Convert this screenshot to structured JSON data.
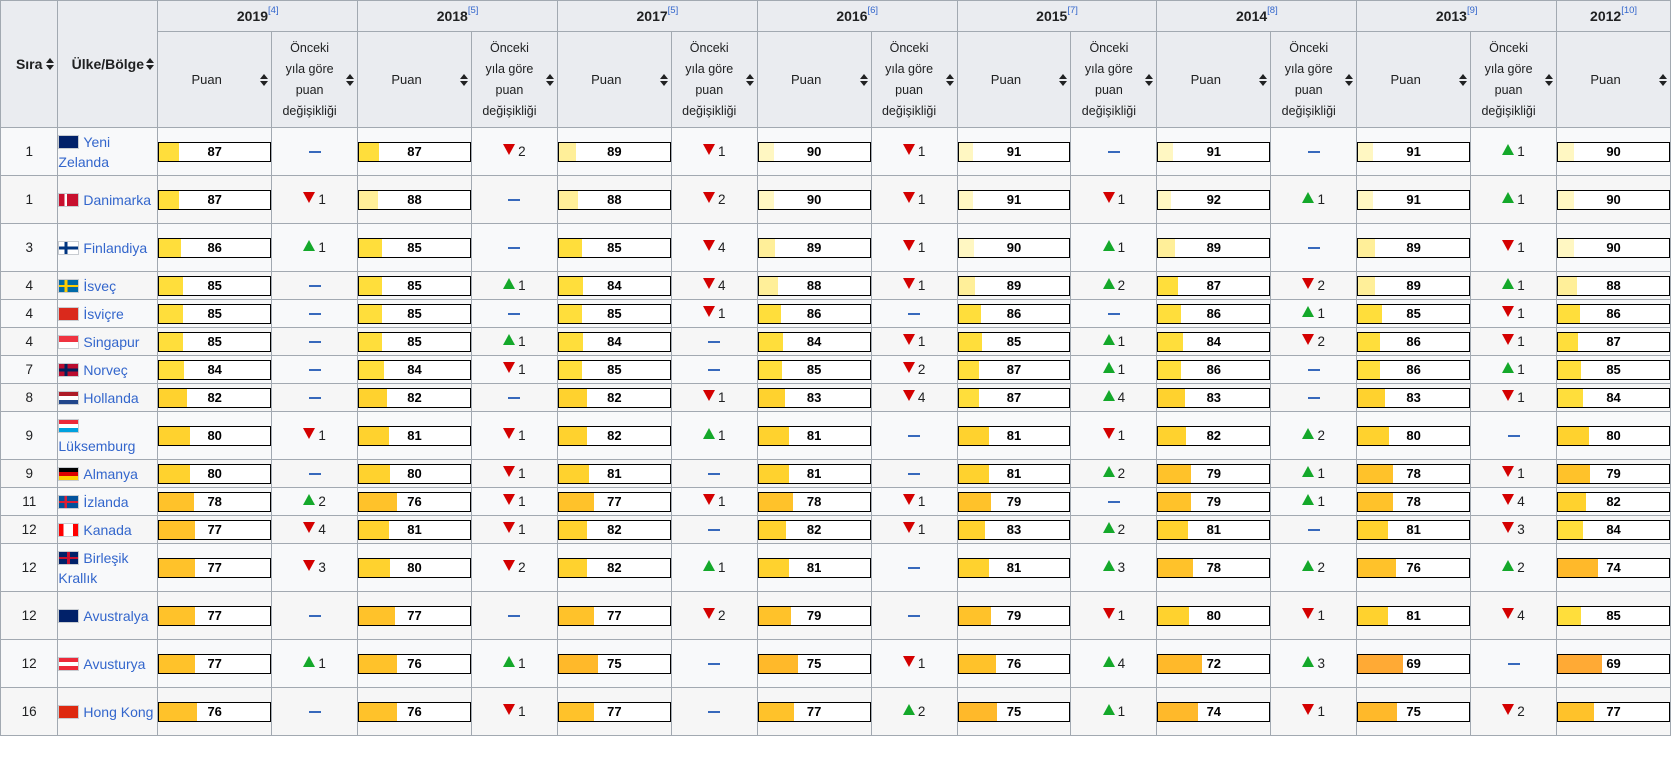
{
  "headers": {
    "rank": "Sıra",
    "country": "Ülke/Bölge",
    "score": "Puan",
    "change_lines": [
      "Önceki",
      "yıla göre",
      "puan",
      "değişikliği"
    ],
    "years": [
      {
        "year": "2019",
        "ref": "[4]"
      },
      {
        "year": "2018",
        "ref": "[5]"
      },
      {
        "year": "2017",
        "ref": "[5]"
      },
      {
        "year": "2016",
        "ref": "[6]"
      },
      {
        "year": "2015",
        "ref": "[7]"
      },
      {
        "year": "2014",
        "ref": "[8]"
      },
      {
        "year": "2013",
        "ref": "[9]"
      },
      {
        "year": "2012",
        "ref": "[10]"
      }
    ]
  },
  "flags": {
    "nz": {
      "icon": "new-zealand-flag-icon",
      "colors": [
        "#012169",
        "#c8102e"
      ]
    },
    "dk": {
      "icon": "denmark-flag-icon",
      "colors": [
        "#c8102e",
        "#ffffff"
      ]
    },
    "fi": {
      "icon": "finland-flag-icon",
      "colors": [
        "#ffffff",
        "#003580"
      ]
    },
    "se": {
      "icon": "sweden-flag-icon",
      "colors": [
        "#006aa7",
        "#fecc00"
      ]
    },
    "ch": {
      "icon": "switzerland-flag-icon",
      "colors": [
        "#da291c",
        "#ffffff"
      ]
    },
    "sg": {
      "icon": "singapore-flag-icon",
      "colors": [
        "#ef3340",
        "#ffffff"
      ]
    },
    "no": {
      "icon": "norway-flag-icon",
      "colors": [
        "#ba0c2f",
        "#ffffff",
        "#00205b"
      ]
    },
    "nl": {
      "icon": "netherlands-flag-icon",
      "colors": [
        "#ae1c28",
        "#ffffff",
        "#21468b"
      ]
    },
    "lu": {
      "icon": "luxembourg-flag-icon",
      "colors": [
        "#ed2939",
        "#ffffff",
        "#00a1de"
      ]
    },
    "de": {
      "icon": "germany-flag-icon",
      "colors": [
        "#000000",
        "#dd0000",
        "#ffce00"
      ]
    },
    "is": {
      "icon": "iceland-flag-icon",
      "colors": [
        "#02529c",
        "#ffffff",
        "#dc1e35"
      ]
    },
    "ca": {
      "icon": "canada-flag-icon",
      "colors": [
        "#ff0000",
        "#ffffff"
      ]
    },
    "gb": {
      "icon": "united-kingdom-flag-icon",
      "colors": [
        "#012169",
        "#ffffff",
        "#c8102e"
      ]
    },
    "au": {
      "icon": "australia-flag-icon",
      "colors": [
        "#012169",
        "#ffffff",
        "#e4002b"
      ]
    },
    "at": {
      "icon": "austria-flag-icon",
      "colors": [
        "#ed2939",
        "#ffffff"
      ]
    },
    "hk": {
      "icon": "hong-kong-flag-icon",
      "colors": [
        "#de2910",
        "#ffffff"
      ]
    }
  },
  "rows": [
    {
      "rank": "1",
      "country": [
        "Yeni",
        "Zelanda"
      ],
      "flag": "nz",
      "cells": [
        [
          "87",
          ""
        ],
        [
          "87",
          "d2"
        ],
        [
          "89",
          "d1"
        ],
        [
          "90",
          "d1"
        ],
        [
          "91",
          ""
        ],
        [
          "91",
          ""
        ],
        [
          "91",
          "u1"
        ],
        [
          "90"
        ]
      ]
    },
    {
      "rank": "1",
      "country": [
        "Danimarka"
      ],
      "flag": "dk",
      "cells": [
        [
          "87",
          "d1"
        ],
        [
          "88",
          ""
        ],
        [
          "88",
          "d2"
        ],
        [
          "90",
          "d1"
        ],
        [
          "91",
          "d1"
        ],
        [
          "92",
          "u1"
        ],
        [
          "91",
          "u1"
        ],
        [
          "90"
        ]
      ]
    },
    {
      "rank": "3",
      "country": [
        "Finlandiya"
      ],
      "flag": "fi",
      "cells": [
        [
          "86",
          "u1"
        ],
        [
          "85",
          ""
        ],
        [
          "85",
          "d4"
        ],
        [
          "89",
          "d1"
        ],
        [
          "90",
          "u1"
        ],
        [
          "89",
          ""
        ],
        [
          "89",
          "d1"
        ],
        [
          "90"
        ]
      ]
    },
    {
      "rank": "4",
      "country": [
        "İsveç"
      ],
      "flag": "se",
      "cells": [
        [
          "85",
          ""
        ],
        [
          "85",
          "u1"
        ],
        [
          "84",
          "d4"
        ],
        [
          "88",
          "d1"
        ],
        [
          "89",
          "u2"
        ],
        [
          "87",
          "d2"
        ],
        [
          "89",
          "u1"
        ],
        [
          "88"
        ]
      ]
    },
    {
      "rank": "4",
      "country": [
        "İsviçre"
      ],
      "flag": "ch",
      "cells": [
        [
          "85",
          ""
        ],
        [
          "85",
          ""
        ],
        [
          "85",
          "d1"
        ],
        [
          "86",
          ""
        ],
        [
          "86",
          ""
        ],
        [
          "86",
          "u1"
        ],
        [
          "85",
          "d1"
        ],
        [
          "86"
        ]
      ]
    },
    {
      "rank": "4",
      "country": [
        "Singapur"
      ],
      "flag": "sg",
      "cells": [
        [
          "85",
          ""
        ],
        [
          "85",
          "u1"
        ],
        [
          "84",
          ""
        ],
        [
          "84",
          "d1"
        ],
        [
          "85",
          "u1"
        ],
        [
          "84",
          "d2"
        ],
        [
          "86",
          "d1"
        ],
        [
          "87"
        ]
      ]
    },
    {
      "rank": "7",
      "country": [
        "Norveç"
      ],
      "flag": "no",
      "cells": [
        [
          "84",
          ""
        ],
        [
          "84",
          "d1"
        ],
        [
          "85",
          ""
        ],
        [
          "85",
          "d2"
        ],
        [
          "87",
          "u1"
        ],
        [
          "86",
          ""
        ],
        [
          "86",
          "u1"
        ],
        [
          "85"
        ]
      ]
    },
    {
      "rank": "8",
      "country": [
        "Hollanda"
      ],
      "flag": "nl",
      "cells": [
        [
          "82",
          ""
        ],
        [
          "82",
          ""
        ],
        [
          "82",
          "d1"
        ],
        [
          "83",
          "d4"
        ],
        [
          "87",
          "u4"
        ],
        [
          "83",
          ""
        ],
        [
          "83",
          "d1"
        ],
        [
          "84"
        ]
      ]
    },
    {
      "rank": "9",
      "country": [
        "Lüksemburg"
      ],
      "flag": "lu",
      "cells": [
        [
          "80",
          "d1"
        ],
        [
          "81",
          "d1"
        ],
        [
          "82",
          "u1"
        ],
        [
          "81",
          ""
        ],
        [
          "81",
          "d1"
        ],
        [
          "82",
          "u2"
        ],
        [
          "80",
          ""
        ],
        [
          "80"
        ]
      ]
    },
    {
      "rank": "9",
      "country": [
        "Almanya"
      ],
      "flag": "de",
      "cells": [
        [
          "80",
          ""
        ],
        [
          "80",
          "d1"
        ],
        [
          "81",
          ""
        ],
        [
          "81",
          ""
        ],
        [
          "81",
          "u2"
        ],
        [
          "79",
          "u1"
        ],
        [
          "78",
          "d1"
        ],
        [
          "79"
        ]
      ]
    },
    {
      "rank": "11",
      "country": [
        "İzlanda"
      ],
      "flag": "is",
      "cells": [
        [
          "78",
          "u2"
        ],
        [
          "76",
          "d1"
        ],
        [
          "77",
          "d1"
        ],
        [
          "78",
          "d1"
        ],
        [
          "79",
          ""
        ],
        [
          "79",
          "u1"
        ],
        [
          "78",
          "d4"
        ],
        [
          "82"
        ]
      ]
    },
    {
      "rank": "12",
      "country": [
        "Kanada"
      ],
      "flag": "ca",
      "cells": [
        [
          "77",
          "d4"
        ],
        [
          "81",
          "d1"
        ],
        [
          "82",
          ""
        ],
        [
          "82",
          "d1"
        ],
        [
          "83",
          "u2"
        ],
        [
          "81",
          ""
        ],
        [
          "81",
          "d3"
        ],
        [
          "84"
        ]
      ]
    },
    {
      "rank": "12",
      "country": [
        "Birleşik",
        "Krallık"
      ],
      "flag": "gb",
      "cells": [
        [
          "77",
          "d3"
        ],
        [
          "80",
          "d2"
        ],
        [
          "82",
          "u1"
        ],
        [
          "81",
          ""
        ],
        [
          "81",
          "u3"
        ],
        [
          "78",
          "u2"
        ],
        [
          "76",
          "u2"
        ],
        [
          "74"
        ]
      ]
    },
    {
      "rank": "12",
      "country": [
        "Avustralya"
      ],
      "flag": "au",
      "cells": [
        [
          "77",
          ""
        ],
        [
          "77",
          ""
        ],
        [
          "77",
          "d2"
        ],
        [
          "79",
          ""
        ],
        [
          "79",
          "d1"
        ],
        [
          "80",
          "d1"
        ],
        [
          "81",
          "d4"
        ],
        [
          "85"
        ]
      ]
    },
    {
      "rank": "12",
      "country": [
        "Avusturya"
      ],
      "flag": "at",
      "cells": [
        [
          "77",
          "u1"
        ],
        [
          "76",
          "u1"
        ],
        [
          "75",
          ""
        ],
        [
          "75",
          "d1"
        ],
        [
          "76",
          "u4"
        ],
        [
          "72",
          "u3"
        ],
        [
          "69",
          ""
        ],
        [
          "69"
        ]
      ]
    },
    {
      "rank": "16",
      "country": [
        "Hong",
        "Kong"
      ],
      "flag": "hk",
      "cells": [
        [
          "76",
          ""
        ],
        [
          "76",
          "d1"
        ],
        [
          "77",
          ""
        ],
        [
          "77",
          "u2"
        ],
        [
          "75",
          "u1"
        ],
        [
          "74",
          "d1"
        ],
        [
          "75",
          "d2"
        ],
        [
          "77"
        ]
      ]
    }
  ]
}
